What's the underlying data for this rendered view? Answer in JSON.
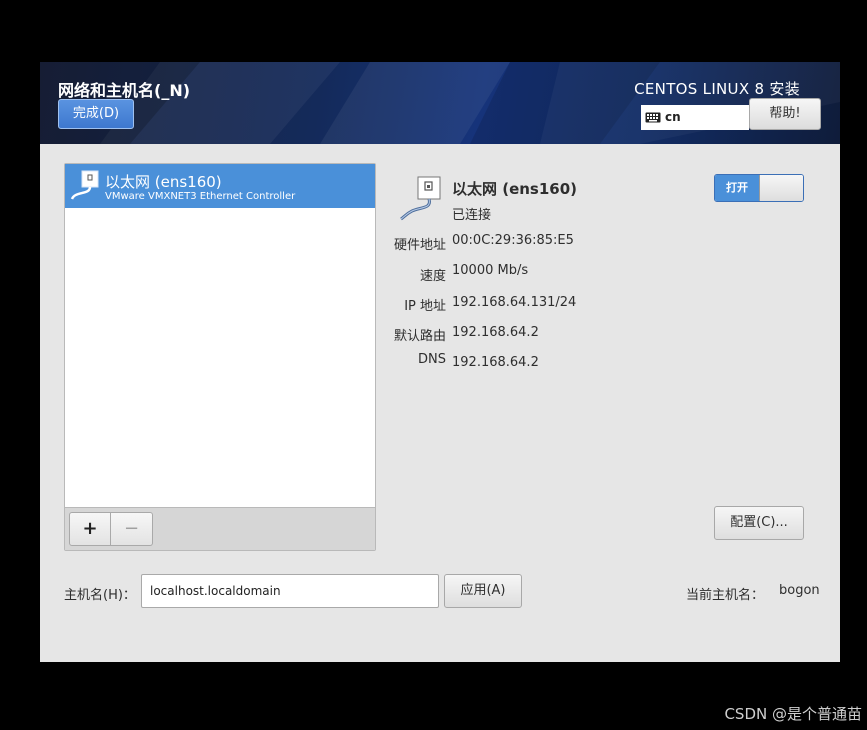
{
  "header": {
    "title": "网络和主机名(_N)",
    "done_label": "完成(D)",
    "os_title": "CENTOS LINUX 8 安装",
    "keyboard_layout": "cn",
    "help_label": "帮助!"
  },
  "interfaces": [
    {
      "name": "以太网 (ens160)",
      "description": "VMware VMXNET3 Ethernet Controller",
      "selected": true
    }
  ],
  "list_toolbar": {
    "add_label": "+",
    "remove_label": "−"
  },
  "detail": {
    "name": "以太网 (ens160)",
    "status": "已连接",
    "toggle_label": "打开",
    "toggle_on": true,
    "fields": [
      {
        "label": "硬件地址",
        "value": "00:0C:29:36:85:E5"
      },
      {
        "label": "速度",
        "value": "10000 Mb/s"
      },
      {
        "label": "IP 地址",
        "value": "192.168.64.131/24"
      },
      {
        "label": "默认路由",
        "value": "192.168.64.2"
      },
      {
        "label": "DNS",
        "value": "192.168.64.2"
      }
    ],
    "configure_label": "配置(C)..."
  },
  "hostname": {
    "label": "主机名(H)：",
    "value": "localhost.localdomain",
    "apply_label": "应用(A)",
    "current_label": "当前主机名：",
    "current_value": "bogon"
  },
  "watermark": "CSDN @是个普通苗",
  "colors": {
    "accent": "#4a90d9",
    "header_dark": "#16337a",
    "window_bg": "#e6e6e6"
  }
}
